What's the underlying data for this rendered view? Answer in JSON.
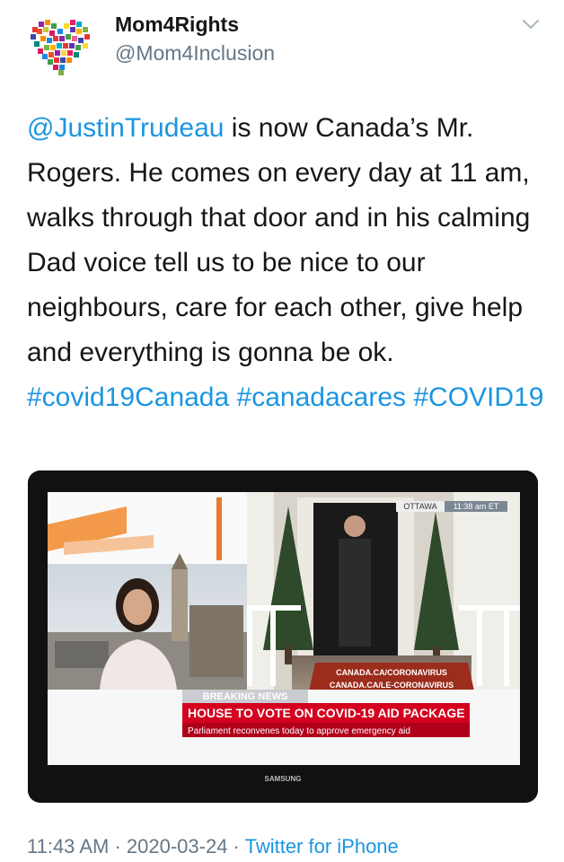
{
  "author": {
    "display_name": "Mom4Rights",
    "handle": "@Mom4Inclusion"
  },
  "tweet": {
    "mention": "@JustinTrudeau",
    "body": " is now Canada’s Mr. Rogers. He comes on every day at 11 am, walks through that door and in his calming Dad voice tell us to be nice to our neighbours, care for each other, give help and everything is gonna be ok. ",
    "hashtags": [
      "#covid19Canada",
      "#canadacares",
      "#COVID19"
    ]
  },
  "tv": {
    "location": "OTTAWA",
    "time": "11:38 am ET",
    "url_line_1": "CANADA.CA/CORONAVIRUS",
    "url_line_2": "CANADA.CA/LE-CORONAVIRUS",
    "breaking_label": "BREAKING NEWS",
    "headline": "HOUSE TO VOTE ON COVID-19 AID PACKAGE",
    "subheadline": "Parliament reconvenes today to approve emergency aid",
    "brand": "SAMSUNG"
  },
  "meta": {
    "time": "11:43 AM",
    "separator": " · ",
    "date": "2020-03-24",
    "app": "Twitter for iPhone"
  },
  "icons": {
    "avatar": "colorful-heart-avatar-icon",
    "menu": "chevron-down-icon"
  },
  "colors": {
    "link": "#1b95e0",
    "secondary_text": "#657786",
    "breaking_red": "#d4001f"
  }
}
